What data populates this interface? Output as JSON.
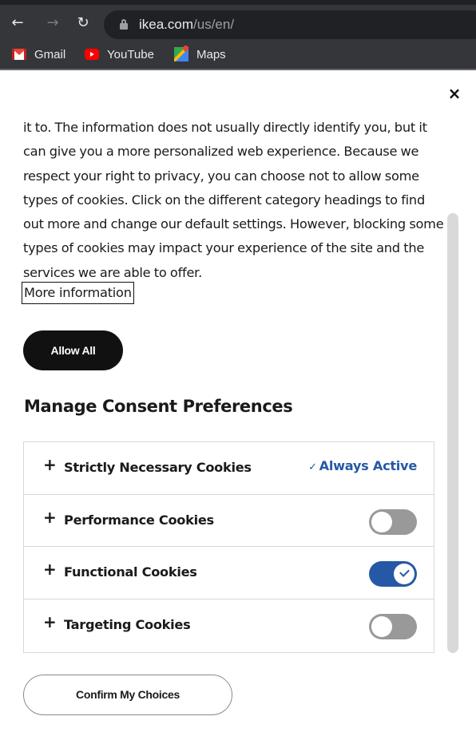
{
  "browser": {
    "nav": {
      "back_icon": "←",
      "forward_icon": "→",
      "reload_icon": "↻"
    },
    "url": {
      "domain": "ikea.com",
      "path": "/us/en/"
    },
    "bookmarks": [
      {
        "label": "Gmail",
        "icon": "gmail-icon"
      },
      {
        "label": "YouTube",
        "icon": "youtube-icon"
      },
      {
        "label": "Maps",
        "icon": "maps-icon"
      }
    ]
  },
  "dialog": {
    "close_label": "×",
    "description": "it to. The information does not usually directly identify you, but it can give you a more personalized web experience. Because we respect your right to privacy, you can choose not to allow some types of cookies. Click on the different category headings to find out more and change our default settings. However, blocking some types of cookies may impact your experience of the site and the services we are able to offer.",
    "more_info_label": "More information",
    "allow_all_label": "Allow All",
    "section_title": "Manage Consent Preferences",
    "categories": [
      {
        "plus": "+",
        "label": "Strictly Necessary Cookies",
        "status": "Always Active",
        "status_check": "✓"
      },
      {
        "plus": "+",
        "label": "Performance Cookies",
        "enabled": false
      },
      {
        "plus": "+",
        "label": "Functional Cookies",
        "enabled": true
      },
      {
        "plus": "+",
        "label": "Targeting Cookies",
        "enabled": false
      }
    ],
    "confirm_label": "Confirm My Choices",
    "colors": {
      "accent": "#2659a5",
      "toggle_off": "#999999",
      "primary_button": "#111111"
    }
  }
}
